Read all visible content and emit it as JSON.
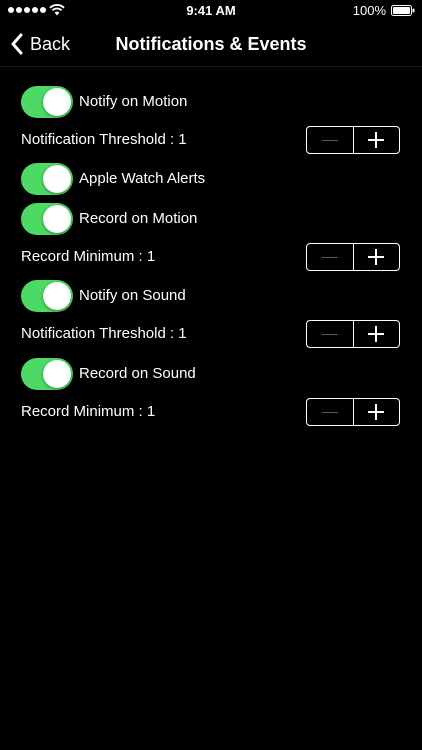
{
  "status_bar": {
    "time": "9:41 AM",
    "battery": "100%",
    "signal_icon": "signal-dots-icon",
    "wifi_icon": "wifi-icon",
    "battery_icon": "battery-icon"
  },
  "nav": {
    "back_label": "Back",
    "title": "Notifications & Events"
  },
  "colors": {
    "background": "#000000",
    "toggle_on": "#4cd964",
    "text": "#ffffff"
  },
  "settings": {
    "notify_motion": {
      "label": "Notify on Motion",
      "on": true
    },
    "motion_threshold": {
      "label": "Notification Threshold : 1"
    },
    "apple_watch": {
      "label": "Apple Watch Alerts",
      "on": true
    },
    "record_motion": {
      "label": "Record on Motion",
      "on": true
    },
    "motion_record_min": {
      "label": "Record Minimum : 1"
    },
    "notify_sound": {
      "label": "Notify on Sound",
      "on": true
    },
    "sound_threshold": {
      "label": "Notification Threshold : 1"
    },
    "record_sound": {
      "label": "Record on Sound",
      "on": true
    },
    "sound_record_min": {
      "label": "Record Minimum : 1"
    }
  }
}
